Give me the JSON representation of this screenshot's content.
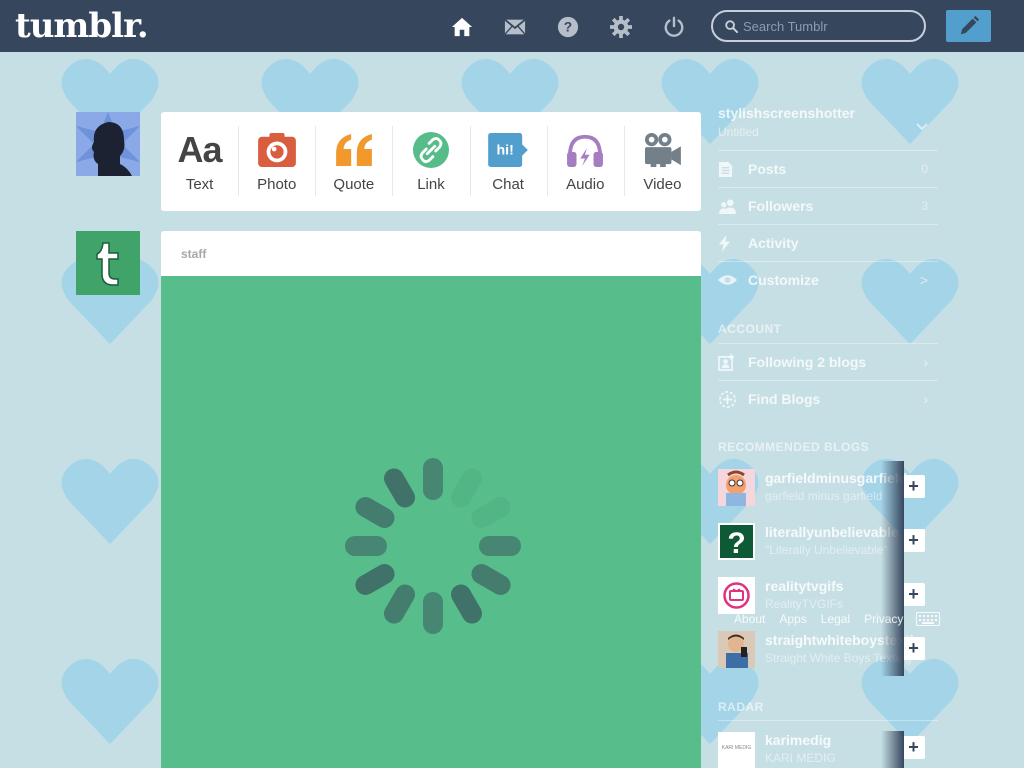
{
  "header": {
    "logo": "tumblr.",
    "search_placeholder": "Search Tumblr",
    "nav": [
      "home-icon",
      "mail-icon",
      "help-icon",
      "gear-icon",
      "power-icon"
    ],
    "compose_icon": "pencil-icon"
  },
  "post_types": [
    {
      "label": "Text",
      "icon": "text-icon",
      "color": "#444444"
    },
    {
      "label": "Photo",
      "icon": "camera-icon",
      "color": "#d95e40"
    },
    {
      "label": "Quote",
      "icon": "quote-icon",
      "color": "#f2992e"
    },
    {
      "label": "Link",
      "icon": "link-icon",
      "color": "#56bc8a"
    },
    {
      "label": "Chat",
      "icon": "chat-icon",
      "color": "#529ecc"
    },
    {
      "label": "Audio",
      "icon": "headphones-icon",
      "color": "#a77dc2"
    },
    {
      "label": "Video",
      "icon": "video-camera-icon",
      "color": "#748089"
    }
  ],
  "post": {
    "author": "staff",
    "body_color": "#56bd8b"
  },
  "sidebar": {
    "blog_name": "stylishscreenshotter",
    "blog_title": "Untitled",
    "items": [
      {
        "label": "Posts",
        "value": "0",
        "icon": "posts-icon"
      },
      {
        "label": "Followers",
        "value": "3",
        "icon": "followers-icon"
      },
      {
        "label": "Activity",
        "value": "",
        "icon": "lightning-icon"
      },
      {
        "label": "Customize",
        "value": ">",
        "icon": "eye-icon"
      }
    ],
    "account_title": "ACCOUNT",
    "account_items": [
      {
        "label": "Following 2 blogs",
        "icon": "following-icon"
      },
      {
        "label": "Find Blogs",
        "icon": "compass-icon"
      }
    ],
    "recommended_title": "RECOMMENDED BLOGS",
    "recommended": [
      {
        "name": "garfieldminusgarfield",
        "sub": "garfield minus garfield"
      },
      {
        "name": "literallyunbelievable",
        "sub": "\"Literally Unbelievable\""
      },
      {
        "name": "realitytvgifs",
        "sub": "RealityTVGIFs"
      },
      {
        "name": "straightwhiteboystexting",
        "sub": "Straight White Boys Texting"
      }
    ],
    "radar_title": "RADAR",
    "radar": {
      "name": "karimedig",
      "sub": "KARI MEDIG",
      "avatar_text": "KARI MEDIG"
    },
    "follow_label": "+"
  },
  "footer": [
    "About",
    "Apps",
    "Legal",
    "Privacy"
  ],
  "colors": {
    "topbar": "#36465d",
    "background": "#c6dfe5",
    "heart": "#a4d4e8",
    "compose": "#529ecc"
  }
}
